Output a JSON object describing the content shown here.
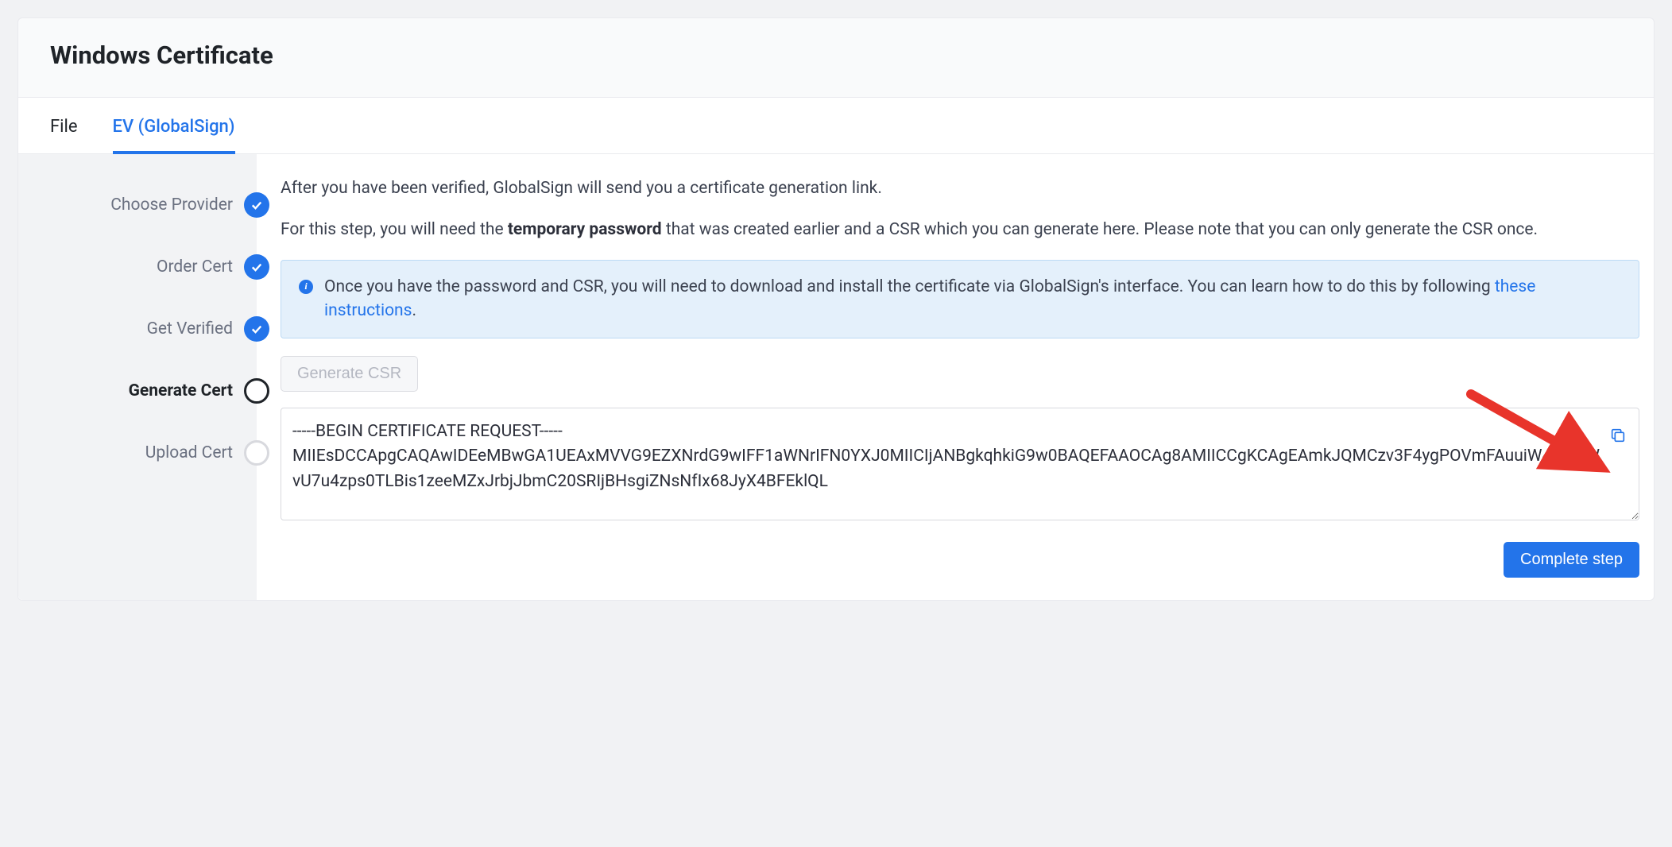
{
  "page_title": "Windows Certificate",
  "tabs": [
    {
      "label": "File"
    },
    {
      "label": "EV (GlobalSign)"
    }
  ],
  "steps": [
    {
      "label": "Choose Provider",
      "state": "done"
    },
    {
      "label": "Order Cert",
      "state": "done"
    },
    {
      "label": "Get Verified",
      "state": "done"
    },
    {
      "label": "Generate Cert",
      "state": "current"
    },
    {
      "label": "Upload Cert",
      "state": "todo"
    }
  ],
  "intro": {
    "line1": "After you have been verified, GlobalSign will send you a certificate generation link.",
    "line2_a": "For this step, you will need the ",
    "line2_bold": "temporary password",
    "line2_b": " that was created earlier and a CSR which you can generate here. Please note that you can only generate the CSR once."
  },
  "info": {
    "text_a": "Once you have the password and CSR, you will need to download and install the certificate via GlobalSign's interface. You can learn how to do this by following ",
    "link_text": "these instructions",
    "text_b": "."
  },
  "generate_csr_label": "Generate CSR",
  "csr_text": "-----BEGIN CERTIFICATE REQUEST-----\nMIIEsDCCApgCAQAwIDEeMBwGA1UEAxMVVG9EZXNrdG9wIFF1aWNrIFN0YXJ0MIICIjANBgkqhkiG9w0BAQEFAAOCAg8AMIICCgKCAgEAmkJQMCzv3F4ygPOVmFAuuiW43mdWvU7u4zps0TLBis1zeeMZxJrbjJbmC20SRIjBHsgiZNsNfIx68JyX4BFEklQL",
  "complete_step_label": "Complete step",
  "colors": {
    "accent": "#2374ea"
  }
}
